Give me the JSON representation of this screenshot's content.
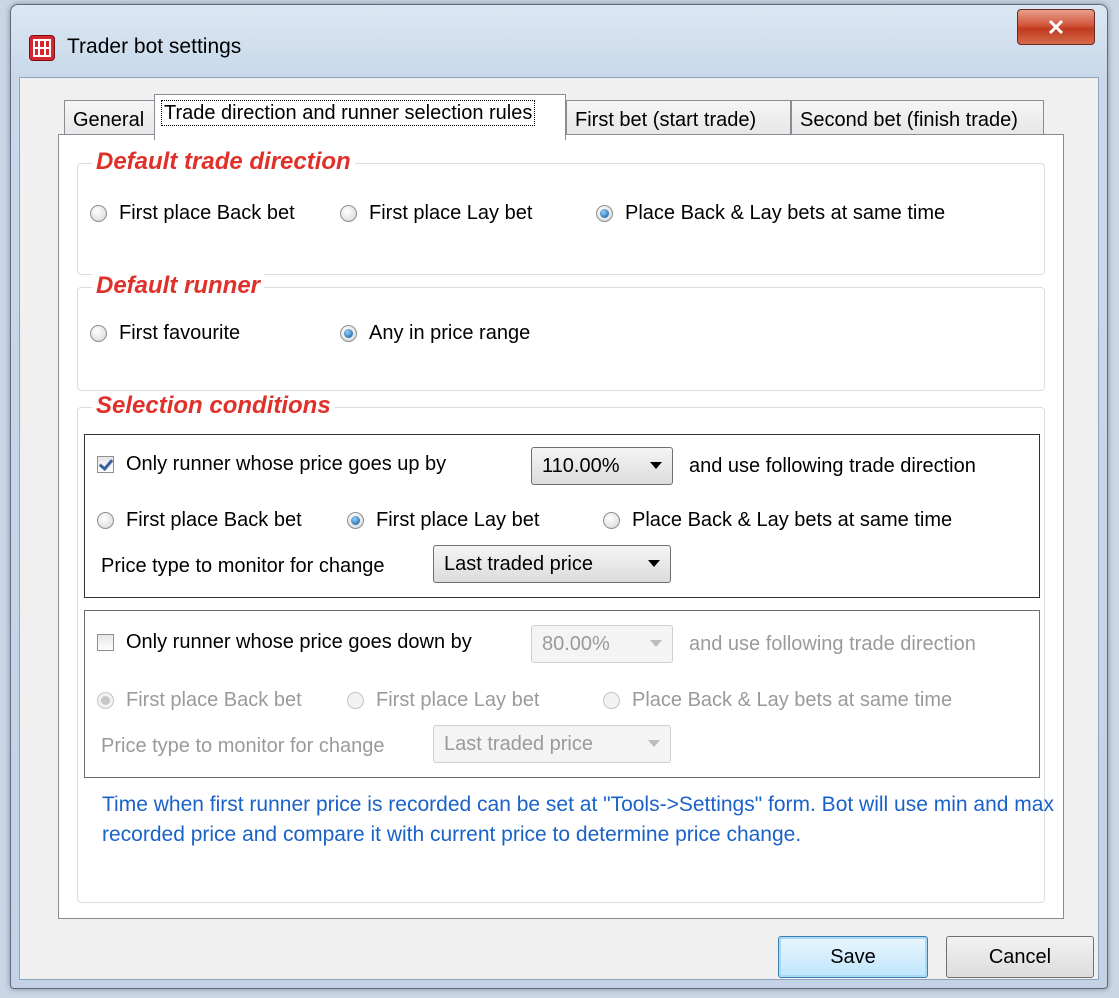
{
  "window": {
    "title": "Trader bot settings"
  },
  "tabs": [
    {
      "label": "General"
    },
    {
      "label": "Trade direction and runner selection rules"
    },
    {
      "label": "First bet (start trade)"
    },
    {
      "label": "Second bet (finish trade)"
    }
  ],
  "default_trade_direction": {
    "title": "Default trade direction",
    "options": [
      "First place Back bet",
      "First place Lay bet",
      "Place Back & Lay bets at same time"
    ],
    "selected": "Place Back & Lay bets at same time"
  },
  "default_runner": {
    "title": "Default runner",
    "options": [
      "First favourite",
      "Any in price range"
    ],
    "selected": "Any in price range"
  },
  "selection_conditions": {
    "title": "Selection conditions",
    "up": {
      "checkbox_label": "Only runner whose price goes up by",
      "checked": true,
      "percent_value": "110.00%",
      "suffix": "and use following trade direction",
      "options": [
        "First place Back bet",
        "First place Lay bet",
        "Place Back & Lay bets at same time"
      ],
      "selected": "First place Lay bet",
      "price_type_label": "Price type to monitor for change",
      "price_type_value": "Last traded price"
    },
    "down": {
      "checkbox_label": "Only runner whose price goes down by",
      "checked": false,
      "percent_value": "80.00%",
      "suffix": "and use following trade direction",
      "options": [
        "First place Back bet",
        "First place Lay bet",
        "Place Back & Lay bets at same time"
      ],
      "selected": "First place Back bet",
      "price_type_label": "Price type to monitor for change",
      "price_type_value": "Last traded price"
    },
    "info": "Time when first runner price is recorded can be set at \"Tools->Settings\" form. Bot will use min and max recorded price and compare it with current price to determine price change."
  },
  "buttons": {
    "save": "Save",
    "cancel": "Cancel"
  },
  "colors": {
    "group_title": "#e0302a",
    "info_text": "#1a62c9",
    "close_button": "#c0391f"
  }
}
